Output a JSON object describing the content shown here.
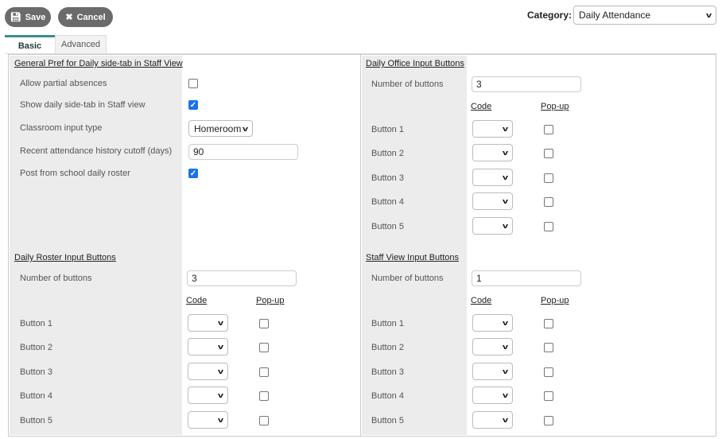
{
  "toolbar": {
    "save_label": "Save",
    "cancel_label": "Cancel",
    "category_label": "Category:",
    "category_value": "Daily Attendance"
  },
  "tabs": [
    {
      "label": "Basic",
      "active": true
    },
    {
      "label": "Advanced",
      "active": false
    }
  ],
  "general": {
    "heading": "General Pref for Daily side-tab in Staff View",
    "allow_partial": {
      "label": "Allow partial absences",
      "checked": false
    },
    "show_daily": {
      "label": "Show daily side-tab in Staff view",
      "checked": true
    },
    "classroom_input": {
      "label": "Classroom input type",
      "value": "Homeroom"
    },
    "cutoff": {
      "label": "Recent attendance history cutoff (days)",
      "value": "90"
    },
    "post_roster": {
      "label": "Post from school daily roster",
      "checked": true
    }
  },
  "sections": [
    {
      "key": "office",
      "heading": "Daily Office Input Buttons",
      "number_label": "Number of buttons",
      "number_value": "3",
      "code_header": "Code",
      "popup_header": "Pop-up",
      "buttons": [
        "Button 1",
        "Button 2",
        "Button 3",
        "Button 4",
        "Button 5"
      ]
    },
    {
      "key": "roster",
      "heading": "Daily Roster Input Buttons",
      "number_label": "Number of buttons",
      "number_value": "3",
      "code_header": "Code",
      "popup_header": "Pop-up",
      "buttons": [
        "Button 1",
        "Button 2",
        "Button 3",
        "Button 4",
        "Button 5"
      ]
    },
    {
      "key": "staff",
      "heading": "Staff View Input Buttons",
      "number_label": "Number of buttons",
      "number_value": "1",
      "code_header": "Code",
      "popup_header": "Pop-up",
      "buttons": [
        "Button 1",
        "Button 2",
        "Button 3",
        "Button 4",
        "Button 5"
      ]
    }
  ],
  "colors": {
    "button_bg": "#6b6b6b",
    "tab_accent": "#3a8f86",
    "checkbox": "#1a73e8",
    "label_bg": "#ececec"
  }
}
